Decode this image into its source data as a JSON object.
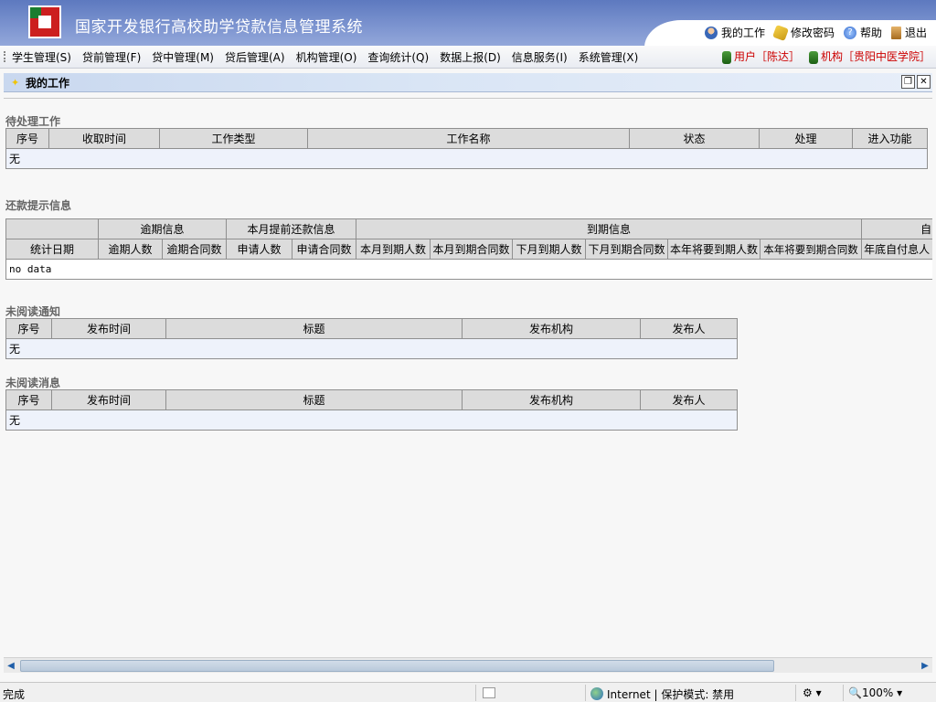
{
  "app": {
    "title": "国家开发银行高校助学贷款信息管理系统",
    "top_links": [
      {
        "label": "我的工作",
        "icon": "user-icon"
      },
      {
        "label": "修改密码",
        "icon": "pen-icon"
      },
      {
        "label": "帮助",
        "icon": "help-icon"
      },
      {
        "label": "退出",
        "icon": "exit-icon"
      }
    ]
  },
  "menu": {
    "items": [
      "学生管理(S)",
      "贷前管理(F)",
      "贷中管理(M)",
      "贷后管理(A)",
      "机构管理(O)",
      "查询统计(Q)",
      "数据上报(D)",
      "信息服务(I)",
      "系统管理(X)"
    ],
    "user": "用户［陈达］",
    "org": "机构［贵阳中医学院］"
  },
  "panel": {
    "title": "我的工作"
  },
  "pending": {
    "title": "待处理工作",
    "headers": [
      "序号",
      "收取时间",
      "工作类型",
      "工作名称",
      "状态",
      "处理",
      "进入功能"
    ],
    "empty": "无"
  },
  "repay": {
    "title": "还款提示信息",
    "groups": [
      "逾期信息",
      "本月提前还款信息",
      "到期信息",
      "自"
    ],
    "headers": [
      "统计日期",
      "逾期人数",
      "逾期合同数",
      "申请人数",
      "申请合同数",
      "本月到期人数",
      "本月到期合同数",
      "下月到期人数",
      "下月到期合同数",
      "本年将要到期人数",
      "本年将要到期合同数",
      "年底自付息人"
    ],
    "empty": "no data"
  },
  "unread_notice": {
    "title": "未阅读通知",
    "headers": [
      "序号",
      "发布时间",
      "标题",
      "发布机构",
      "发布人"
    ],
    "empty": "无"
  },
  "unread_msg": {
    "title": "未阅读消息",
    "headers": [
      "序号",
      "发布时间",
      "标题",
      "发布机构",
      "发布人"
    ],
    "empty": "无"
  },
  "status": {
    "left": "完成",
    "zone": "Internet | 保护模式: 禁用",
    "zoom": "100%"
  }
}
